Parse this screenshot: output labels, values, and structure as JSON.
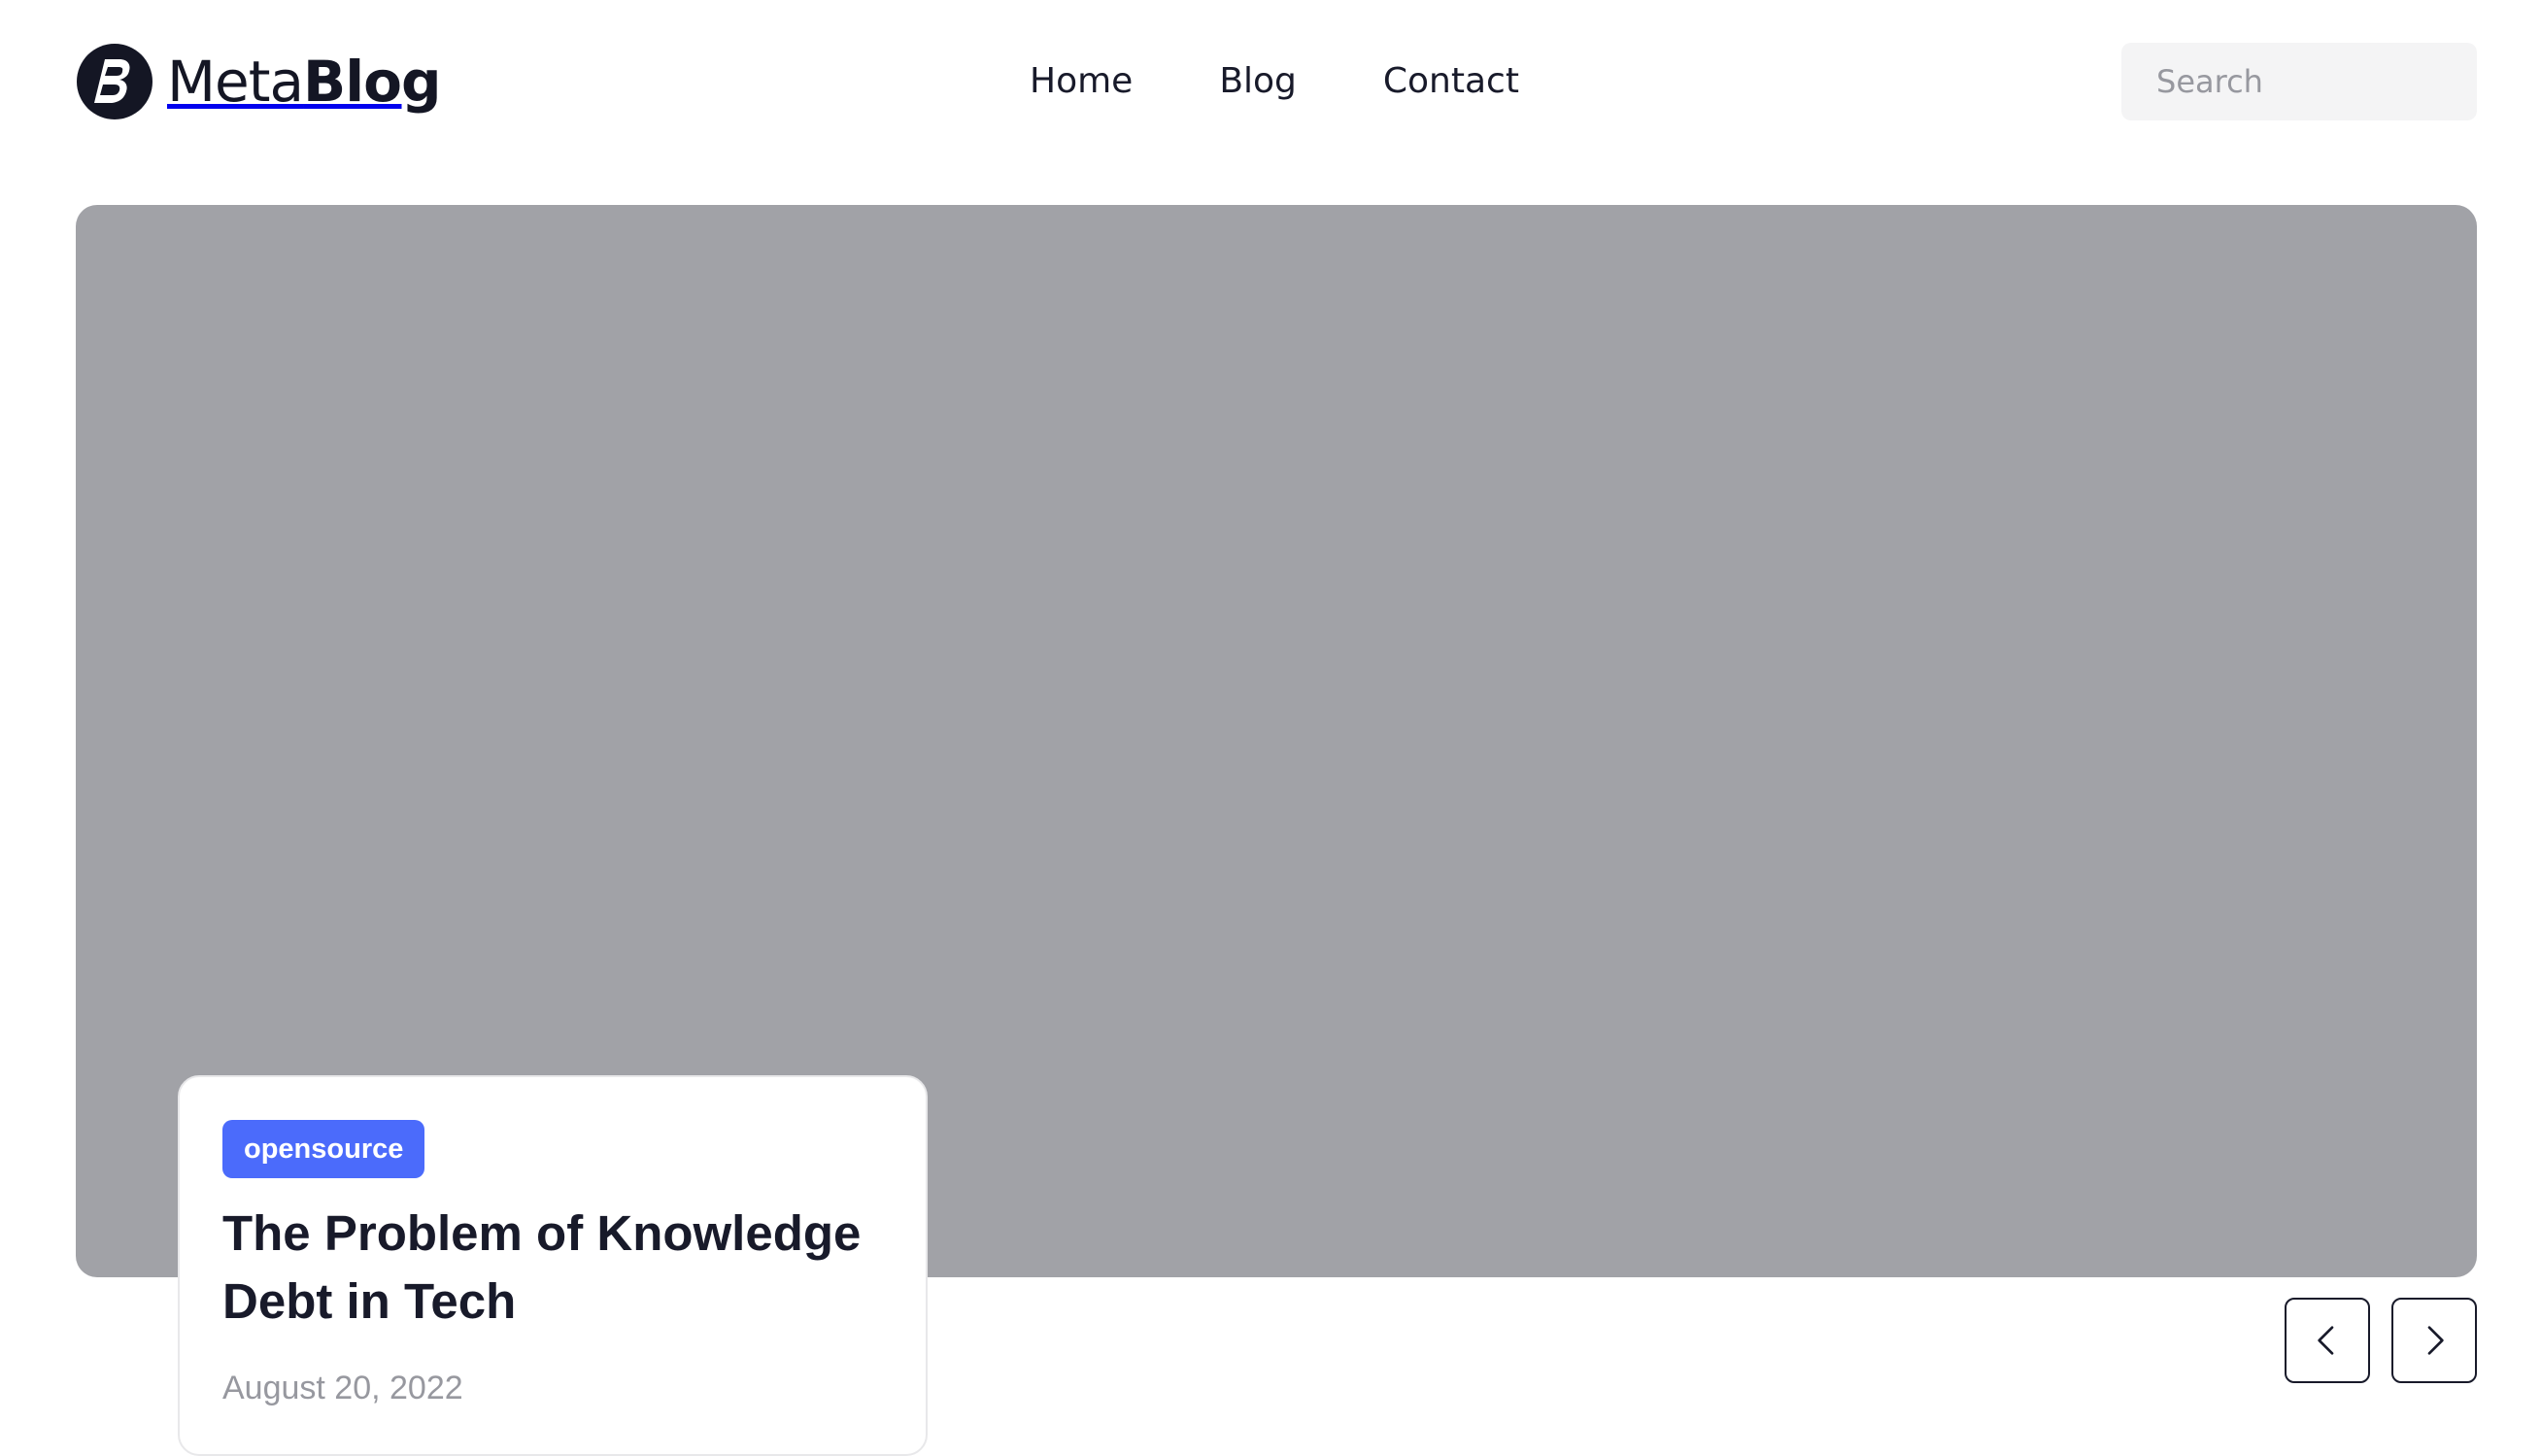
{
  "brand": {
    "name_light": "Meta",
    "name_bold": "Blog",
    "mark_icon": "metablog-logo-icon",
    "color": "#141624"
  },
  "nav": {
    "items": [
      {
        "label": "Home"
      },
      {
        "label": "Blog"
      },
      {
        "label": "Contact"
      }
    ]
  },
  "search": {
    "placeholder": "Search",
    "value": "",
    "icon": "search-icon"
  },
  "hero": {
    "background_color": "#a1a2a7",
    "featured_post": {
      "tag": "opensource",
      "tag_color": "#4b6bfb",
      "title": "The Problem of Knowledge Debt in Tech",
      "date": "August 20, 2022"
    }
  },
  "pagination": {
    "prev_icon": "chevron-left-icon",
    "next_icon": "chevron-right-icon"
  }
}
